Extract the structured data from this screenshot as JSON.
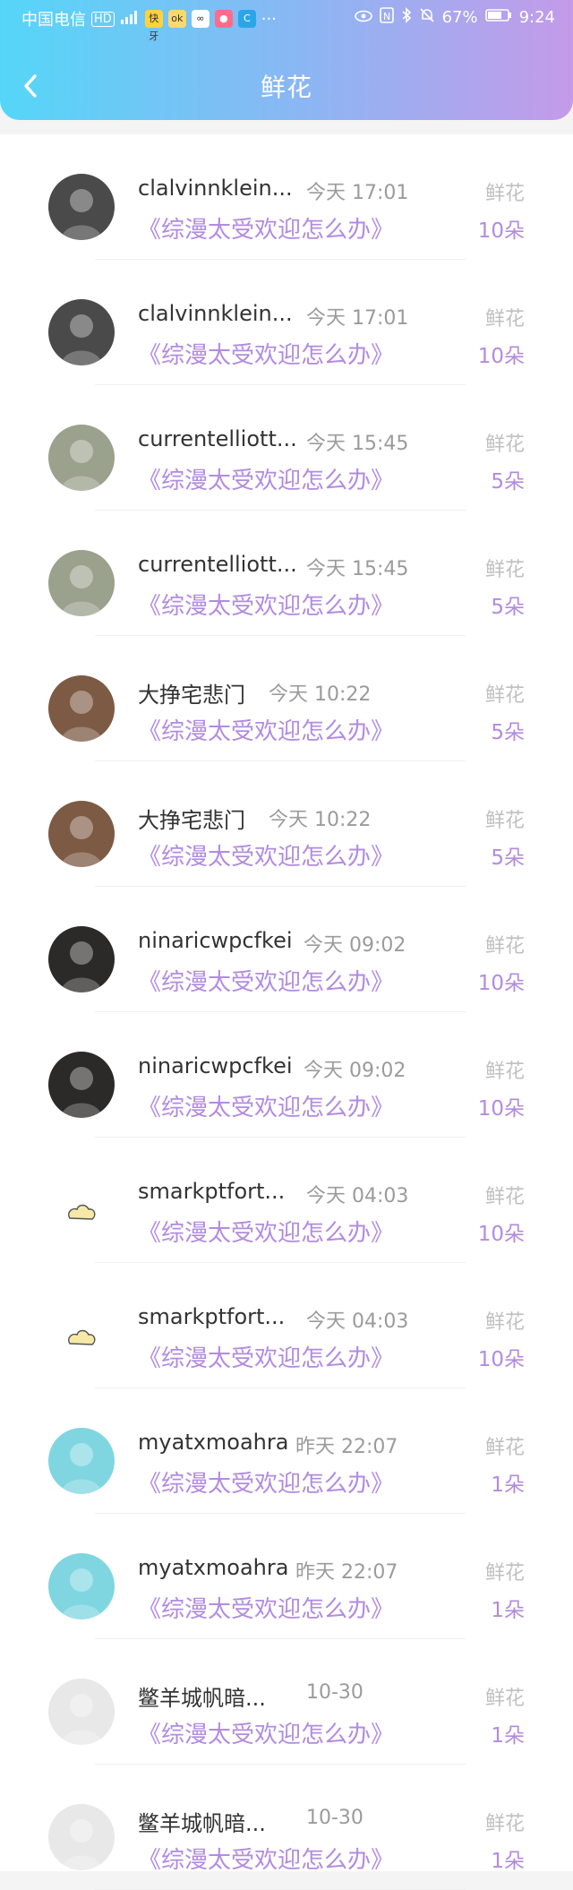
{
  "status_bar": {
    "carrier": "中国电信",
    "network": "HD",
    "app_icons": [
      "快牙",
      "ok",
      "∞",
      "●",
      "C"
    ],
    "more": "···",
    "battery": "67%",
    "time": "9:24"
  },
  "header": {
    "back_label": "‹",
    "title": "鲜花"
  },
  "list": {
    "items": [
      {
        "name": "clalvinnklein...",
        "time": "今天 17:01",
        "book": "《综漫太受欢迎怎么办》",
        "flower_label": "鲜花",
        "count": "10朵",
        "avatar_color": "#4a4a4a"
      },
      {
        "name": "clalvinnklein...",
        "time": "今天 17:01",
        "book": "《综漫太受欢迎怎么办》",
        "flower_label": "鲜花",
        "count": "10朵",
        "avatar_color": "#4a4a4a"
      },
      {
        "name": "currentelliott...",
        "time": "今天 15:45",
        "book": "《综漫太受欢迎怎么办》",
        "flower_label": "鲜花",
        "count": "5朵",
        "avatar_color": "#9aa18c"
      },
      {
        "name": "currentelliott...",
        "time": "今天 15:45",
        "book": "《综漫太受欢迎怎么办》",
        "flower_label": "鲜花",
        "count": "5朵",
        "avatar_color": "#9aa18c"
      },
      {
        "name": "大挣宅悲门",
        "time": "今天 10:22",
        "book": "《综漫太受欢迎怎么办》",
        "flower_label": "鲜花",
        "count": "5朵",
        "avatar_color": "#7d5a44"
      },
      {
        "name": "大挣宅悲门",
        "time": "今天 10:22",
        "book": "《综漫太受欢迎怎么办》",
        "flower_label": "鲜花",
        "count": "5朵",
        "avatar_color": "#7d5a44"
      },
      {
        "name": "ninaricwpcfkei",
        "time": "今天 09:02",
        "book": "《综漫太受欢迎怎么办》",
        "flower_label": "鲜花",
        "count": "10朵",
        "avatar_color": "#2c2a28"
      },
      {
        "name": "ninaricwpcfkei",
        "time": "今天 09:02",
        "book": "《综漫太受欢迎怎么办》",
        "flower_label": "鲜花",
        "count": "10朵",
        "avatar_color": "#2c2a28"
      },
      {
        "name": "smarkptfort...",
        "time": "今天 04:03",
        "book": "《综漫太受欢迎怎么办》",
        "flower_label": "鲜花",
        "count": "10朵",
        "avatar_color": "#ffffff"
      },
      {
        "name": "smarkptfort...",
        "time": "今天 04:03",
        "book": "《综漫太受欢迎怎么办》",
        "flower_label": "鲜花",
        "count": "10朵",
        "avatar_color": "#ffffff"
      },
      {
        "name": "myatxmoahra",
        "time": "昨天 22:07",
        "book": "《综漫太受欢迎怎么办》",
        "flower_label": "鲜花",
        "count": "1朵",
        "avatar_color": "#7fd6e0"
      },
      {
        "name": "myatxmoahra",
        "time": "昨天 22:07",
        "book": "《综漫太受欢迎怎么办》",
        "flower_label": "鲜花",
        "count": "1朵",
        "avatar_color": "#7fd6e0"
      },
      {
        "name": "鳖羊城帆暗...",
        "time": "10-30",
        "book": "《综漫太受欢迎怎么办》",
        "flower_label": "鲜花",
        "count": "1朵",
        "avatar_color": "#e8e8e8"
      },
      {
        "name": "鳖羊城帆暗...",
        "time": "10-30",
        "book": "《综漫太受欢迎怎么办》",
        "flower_label": "鲜花",
        "count": "1朵",
        "avatar_color": "#e8e8e8"
      }
    ]
  }
}
